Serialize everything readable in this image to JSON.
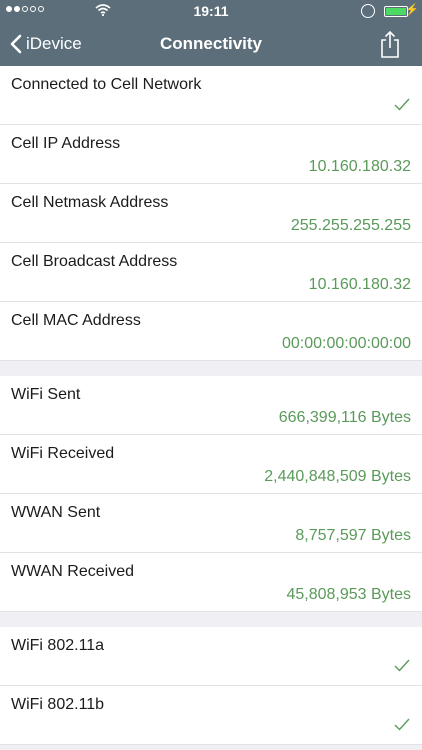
{
  "status": {
    "time": "19:11"
  },
  "nav": {
    "back_label": "iDevice",
    "title": "Connectivity"
  },
  "sections": [
    {
      "rows": [
        {
          "label": "Connected to Cell Network",
          "checked": true
        },
        {
          "label": "Cell IP Address",
          "value": "10.160.180.32"
        },
        {
          "label": "Cell Netmask Address",
          "value": "255.255.255.255"
        },
        {
          "label": "Cell Broadcast Address",
          "value": "10.160.180.32"
        },
        {
          "label": "Cell MAC Address",
          "value": "00:00:00:00:00:00"
        }
      ]
    },
    {
      "rows": [
        {
          "label": "WiFi Sent",
          "value": "666,399,116 Bytes"
        },
        {
          "label": "WiFi Received",
          "value": "2,440,848,509 Bytes"
        },
        {
          "label": "WWAN Sent",
          "value": "8,757,597 Bytes"
        },
        {
          "label": "WWAN Received",
          "value": "45,808,953 Bytes"
        }
      ]
    },
    {
      "rows": [
        {
          "label": "WiFi 802.11a",
          "checked": true
        },
        {
          "label": "WiFi 802.11b",
          "checked": true
        }
      ]
    }
  ],
  "colors": {
    "nav_background": "#5c6e7a",
    "value_green": "#5a9a5a",
    "check_green": "#5a9a5a"
  },
  "icons": [
    "signal-dots-icon",
    "wifi-icon",
    "rotation-lock-icon",
    "battery-icon",
    "chevron-left-icon",
    "share-icon",
    "checkmark-icon"
  ]
}
